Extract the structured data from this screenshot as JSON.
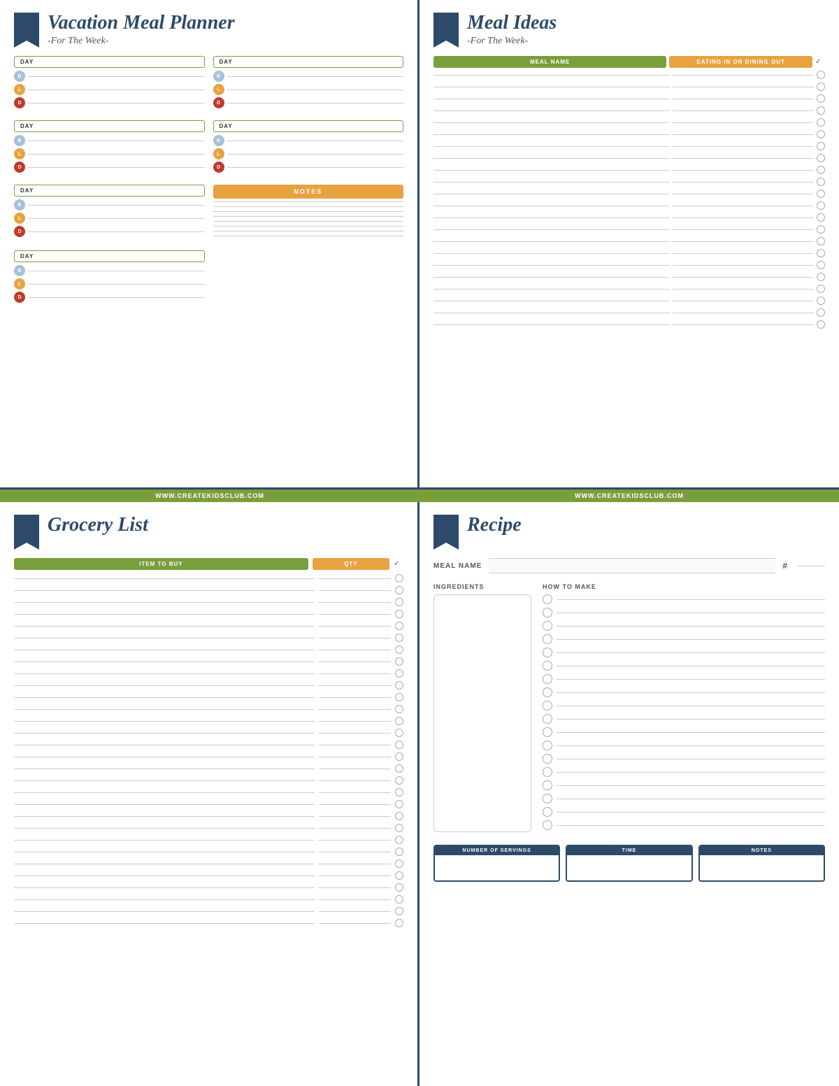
{
  "topLeft": {
    "title": "Vacation Meal Planner",
    "subtitle": "-For The Week-",
    "days": [
      {
        "label": "DAY"
      },
      {
        "label": "DAY"
      },
      {
        "label": "DAY"
      },
      {
        "label": "DAY"
      },
      {
        "label": "DAY"
      },
      {
        "label": "DAY"
      },
      {
        "label": "DAY"
      }
    ],
    "meals": [
      "B",
      "L",
      "D"
    ],
    "notesLabel": "NOTES"
  },
  "topRight": {
    "title": "Meal Ideas",
    "subtitle": "-For The Week-",
    "columns": {
      "mealName": "MEAL NAME",
      "eating": "EATING IN OR DINING OUT"
    },
    "rowCount": 22
  },
  "divider": {
    "text1": "WWW.CREATEKIDSCLUB.COM",
    "text2": "WWW.CREATEKIDSCLUB.COM"
  },
  "bottomLeft": {
    "title": "Grocery List",
    "columns": {
      "item": "ITEM TO BUY",
      "qty": "QTY"
    },
    "checkmark": "✓",
    "rowCount": 30
  },
  "bottomRight": {
    "title": "Recipe",
    "mealNameLabel": "MEAL NAME",
    "hashLabel": "#",
    "ingredientsLabel": "INGREDIENTS",
    "howToMakeLabel": "HOW TO MAKE",
    "howToRowCount": 18,
    "footer": {
      "servings": "NUMBER OF SERVINGS",
      "time": "TIME",
      "notes": "NOTES"
    }
  }
}
